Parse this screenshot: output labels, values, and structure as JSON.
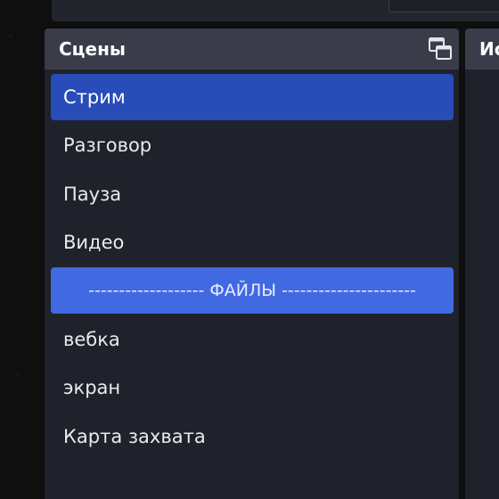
{
  "scenes_dock": {
    "title": "Сцены",
    "float_icon": "undock-window-icon",
    "items": [
      {
        "label": "Стрим",
        "state": "selected"
      },
      {
        "label": "Разговор",
        "state": "normal"
      },
      {
        "label": "Пауза",
        "state": "normal"
      },
      {
        "label": "Видео",
        "state": "normal"
      },
      {
        "label": "------------------- ФАЙЛЫ ----------------------",
        "state": "highlighted"
      },
      {
        "label": "вебка",
        "state": "normal"
      },
      {
        "label": "экран",
        "state": "normal"
      },
      {
        "label": "Карта захвата",
        "state": "normal"
      }
    ]
  },
  "sources_dock": {
    "title": "Ис"
  },
  "colors": {
    "selected_bg": "#284cb8",
    "highlighted_bg": "#4169e1",
    "list_bg": "#1f222a",
    "header_bg": "#3a3d49"
  }
}
